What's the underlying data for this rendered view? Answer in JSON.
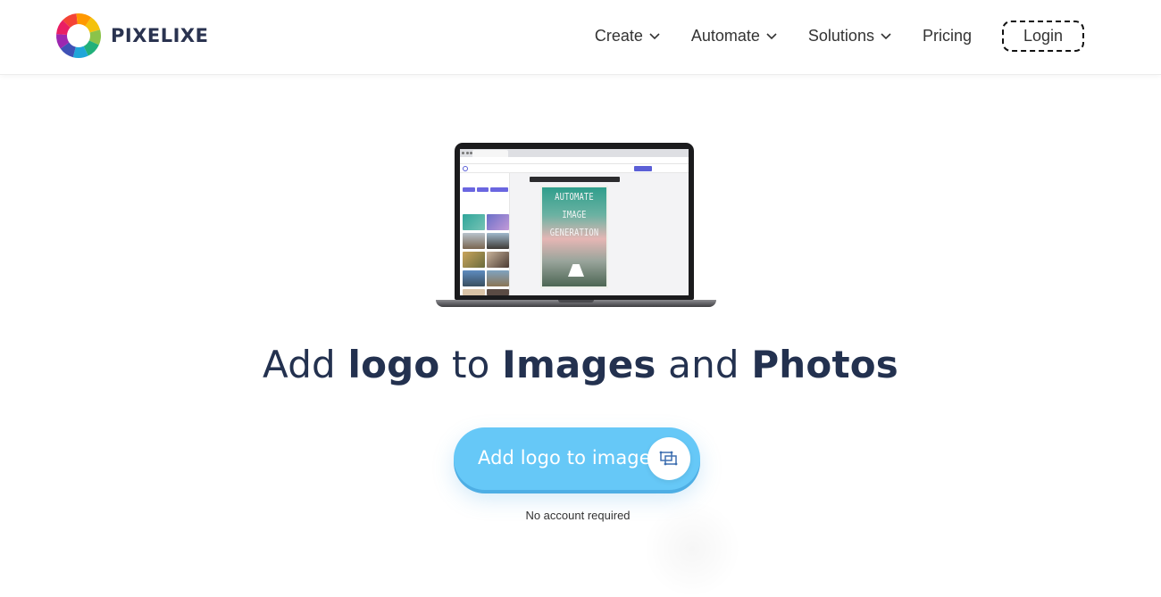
{
  "brand": {
    "name": "PIXELIXE",
    "logo_colors": [
      "#f4c20d",
      "#8bc34a",
      "#21b07a",
      "#1fa6d9",
      "#3f51b5",
      "#9c27b0",
      "#e91e63",
      "#f44336",
      "#ff9800"
    ]
  },
  "nav": {
    "items": [
      {
        "label": "Create",
        "has_dropdown": true
      },
      {
        "label": "Automate",
        "has_dropdown": true
      },
      {
        "label": "Solutions",
        "has_dropdown": true
      },
      {
        "label": "Pricing",
        "has_dropdown": false
      }
    ],
    "login_label": "Login"
  },
  "hero": {
    "mockup": {
      "poster_lines": [
        "AUTOMATE",
        "IMAGE",
        "GENERATION"
      ]
    },
    "headline": [
      {
        "text": "Add ",
        "weight": "light"
      },
      {
        "text": "logo",
        "weight": "bold"
      },
      {
        "text": " to ",
        "weight": "light"
      },
      {
        "text": "Images",
        "weight": "bold"
      },
      {
        "text": " and ",
        "weight": "light"
      },
      {
        "text": "Photos",
        "weight": "bold"
      }
    ],
    "cta": {
      "label": "Add logo to image",
      "icon": "image-resize-icon",
      "color": "#66c8f7"
    },
    "subnote": "No account required"
  },
  "colors": {
    "text_dark": "#23314f",
    "nav_text": "#333333",
    "accent": "#66c8f7"
  }
}
